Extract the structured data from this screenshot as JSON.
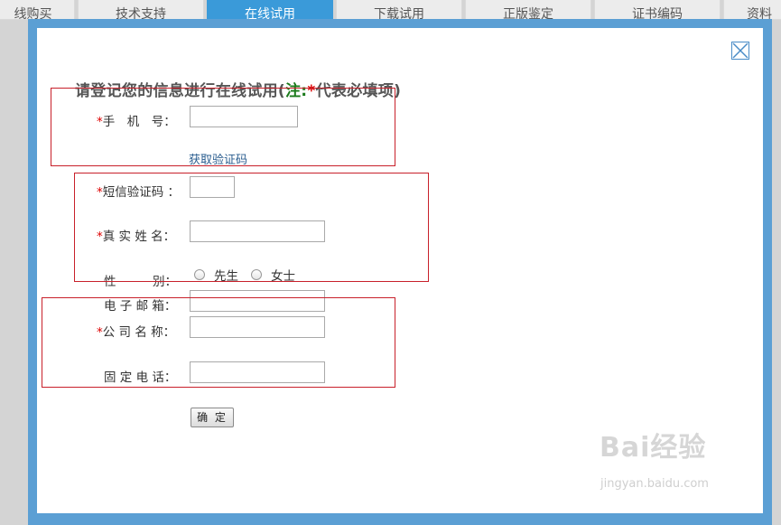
{
  "tabs": [
    "线购买",
    "技术支持",
    "在线试用",
    "下载试用",
    "正版鉴定",
    "证书编码",
    "资料"
  ],
  "form": {
    "title_main": "请登记您的信息进行在线试用(",
    "title_note": "注:",
    "title_star": "*",
    "title_tail": "代表必填项)",
    "phone_label": "手　机　号：",
    "get_code_link": "获取验证码",
    "sms_label": "短信验证码 ：",
    "name_label": "真 实 姓 名：",
    "gender_label": "性　　　别：",
    "gender_male": "先生",
    "gender_female": "女士",
    "email_label": "电 子 邮 箱：",
    "company_label": "公 司 名 称：",
    "tel_label": "固 定 电 话：",
    "submit_label": "确 定",
    "required_mark": "*"
  },
  "watermark": {
    "brand": "Bai经验",
    "url": "jingyan.baidu.com"
  },
  "colors": {
    "modal_border": "#5b9fd4",
    "active_tab": "#3a9ad9",
    "required": "#dd0000",
    "note": "#1a7a1a",
    "highlight_box": "#c8202a"
  }
}
